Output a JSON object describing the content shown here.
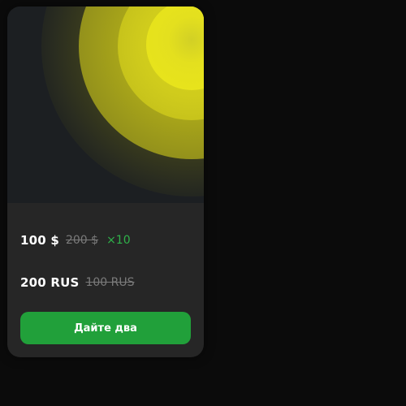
{
  "colors": {
    "page_background": "#0b0b0b",
    "card_background": "#262626",
    "hero_background": "#1c1f22",
    "accent_yellow": "#e4e01e",
    "old_price": "#7a7a7a",
    "multiplier": "#2fb24a",
    "button": "#21a03a",
    "text": "#ffffff"
  },
  "offer": {
    "price_current": "100 $",
    "price_old": "200 $",
    "multiplier": "×10"
  },
  "offer2": {
    "price_current": "200 RUS",
    "price_old": "100 RUS"
  },
  "button": {
    "label": "Дайте два"
  }
}
